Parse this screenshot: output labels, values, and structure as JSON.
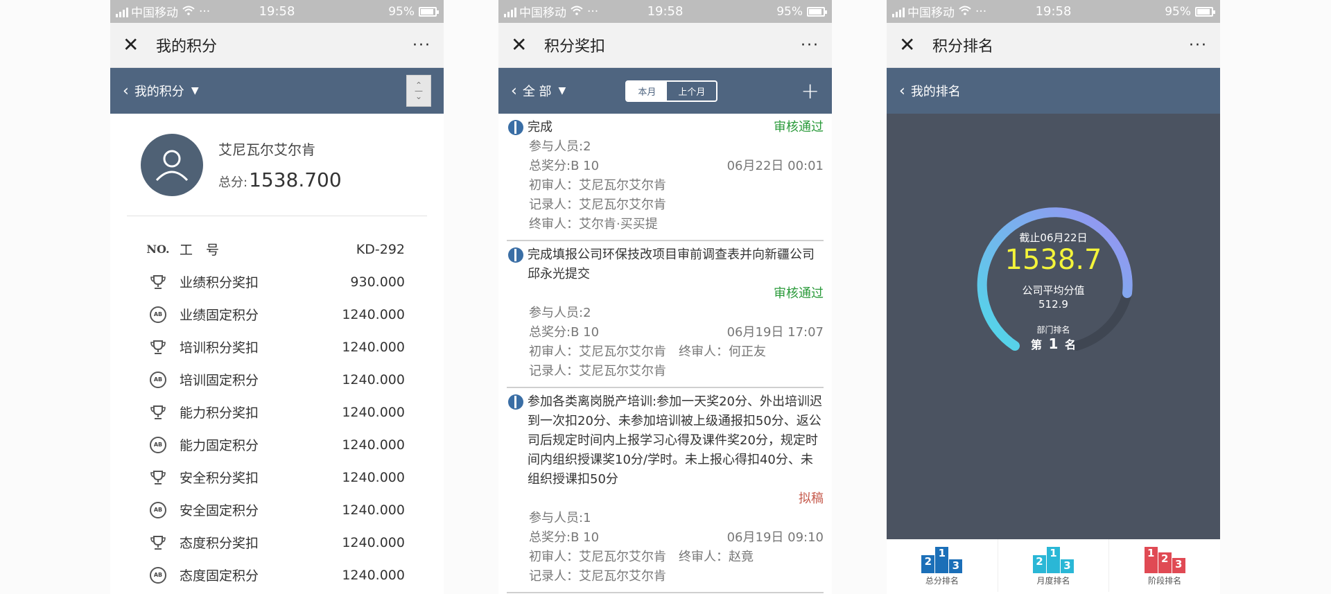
{
  "status": {
    "carrier": "中国移动",
    "more": "···",
    "time": "19:58",
    "battery": "95%"
  },
  "p1": {
    "title": "我的积分",
    "more": "···",
    "nav_label": "我的积分",
    "name": "艾尼瓦尔艾尔肯",
    "score_label": "总分:",
    "score": "1538.700",
    "rows": [
      {
        "icon": "no-icon",
        "label": "工　号",
        "value": "KD-292"
      },
      {
        "icon": "trophy-icon",
        "label": "业绩积分奖扣",
        "value": "930.000"
      },
      {
        "icon": "ab-badge-icon",
        "label": "业绩固定积分",
        "value": "1240.000"
      },
      {
        "icon": "trophy-icon",
        "label": "培训积分奖扣",
        "value": "1240.000"
      },
      {
        "icon": "ab-badge-icon",
        "label": "培训固定积分",
        "value": "1240.000"
      },
      {
        "icon": "trophy-icon",
        "label": "能力积分奖扣",
        "value": "1240.000"
      },
      {
        "icon": "ab-badge-icon",
        "label": "能力固定积分",
        "value": "1240.000"
      },
      {
        "icon": "trophy-icon",
        "label": "安全积分奖扣",
        "value": "1240.000"
      },
      {
        "icon": "ab-badge-icon",
        "label": "安全固定积分",
        "value": "1240.000"
      },
      {
        "icon": "trophy-icon",
        "label": "态度积分奖扣",
        "value": "1240.000"
      },
      {
        "icon": "ab-badge-icon",
        "label": "态度固定积分",
        "value": "1240.000"
      }
    ]
  },
  "p2": {
    "title": "积分奖扣",
    "more": "···",
    "nav_label": "全 部",
    "seg_current": "本月",
    "seg_prev": "上个月",
    "records": [
      {
        "title": "完成",
        "status": "审核通过",
        "participants": "参与人员:2",
        "award": "总奖分:B 10",
        "date": "06月22日 00:01",
        "reviewer1": "初审人：艾尼瓦尔艾尔肯",
        "recorder": "记录人：艾尼瓦尔艾尔肯",
        "final": "终审人：艾尔肯·买买提"
      },
      {
        "title": "完成填报公司环保技改项目审前调查表并向新疆公司邱永光提交",
        "status": "审核通过",
        "participants": "参与人员:2",
        "award": "总奖分:B 10",
        "date": "06月19日 17:07",
        "reviewer1": "初审人：艾尼瓦尔艾尔肯",
        "final": "终审人：何正友",
        "recorder": "记录人：艾尼瓦尔艾尔肯"
      },
      {
        "title": "参加各类离岗脱产培训:参加一天奖20分、外出培训迟到一次扣20分、未参加培训被上级通报扣50分、返公司后规定时间内上报学习心得及课件奖20分，规定时间内组织授课奖10分/学时。未上报心得扣40分、未组织授课扣50分",
        "status": "拟稿",
        "participants": "参与人员:1",
        "award": "总奖分:B 10",
        "date": "06月19日 09:10",
        "reviewer1": "初审人：艾尼瓦尔艾尔肯",
        "final": "终审人：赵竟",
        "recorder": "记录人：艾尼瓦尔艾尔肯"
      }
    ],
    "colors": {
      "ok": "#2a9a3a",
      "draft": "#c65b4d"
    }
  },
  "p3": {
    "title": "积分排名",
    "more": "···",
    "nav_label": "我的排名",
    "as_of": "截止06月22日",
    "score": "1538.7",
    "avg_label": "公司平均分值",
    "avg_value": "512.9",
    "dept_label": "部门排名",
    "rank_prefix": "第",
    "rank": "1",
    "rank_suffix": "名",
    "tabs": [
      {
        "label": "总分排名",
        "icon": "podium-blue-icon"
      },
      {
        "label": "月度排名",
        "icon": "podium-cyan-icon"
      },
      {
        "label": "阶段排名",
        "icon": "podium-red-icon"
      }
    ],
    "colors": {
      "score": "#f4f43a",
      "bg": "#4b5361"
    }
  }
}
